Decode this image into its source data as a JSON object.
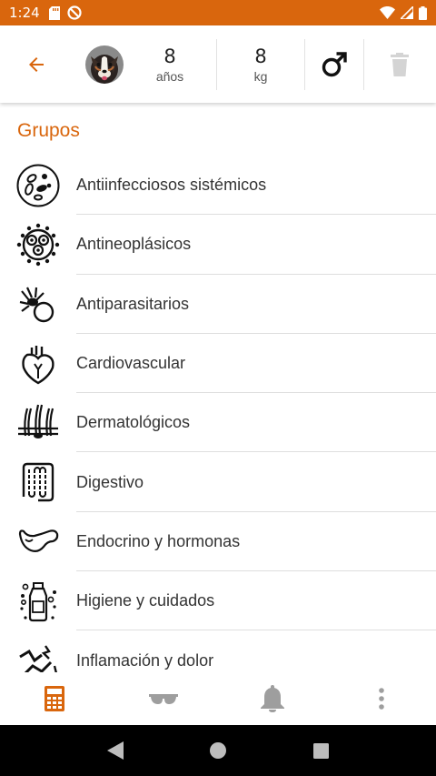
{
  "status_bar": {
    "time": "1:24",
    "color": "#d9660d"
  },
  "header": {
    "age_value": "8",
    "age_unit": "años",
    "weight_value": "8",
    "weight_unit": "kg",
    "gender_icon": "male-icon",
    "accent": "#d9660d"
  },
  "section": {
    "title": "Grupos"
  },
  "groups": [
    {
      "label": "Antiinfecciosos sistémicos",
      "icon": "bacteria-icon"
    },
    {
      "label": "Antineoplásicos",
      "icon": "cell-icon"
    },
    {
      "label": "Antiparasitarios",
      "icon": "tick-icon"
    },
    {
      "label": "Cardiovascular",
      "icon": "heart-icon"
    },
    {
      "label": "Dermatológicos",
      "icon": "skin-icon"
    },
    {
      "label": "Digestivo",
      "icon": "intestine-icon"
    },
    {
      "label": "Endocrino y hormonas",
      "icon": "pancreas-icon"
    },
    {
      "label": "Higiene y cuidados",
      "icon": "bottle-icon"
    },
    {
      "label": "Inflamación y dolor",
      "icon": "joint-pain-icon"
    }
  ],
  "bottom_nav": [
    {
      "icon": "calculator-icon",
      "active": true
    },
    {
      "icon": "glasses-icon",
      "active": false
    },
    {
      "icon": "bell-icon",
      "active": false
    },
    {
      "icon": "more-vertical-icon",
      "active": false
    }
  ]
}
